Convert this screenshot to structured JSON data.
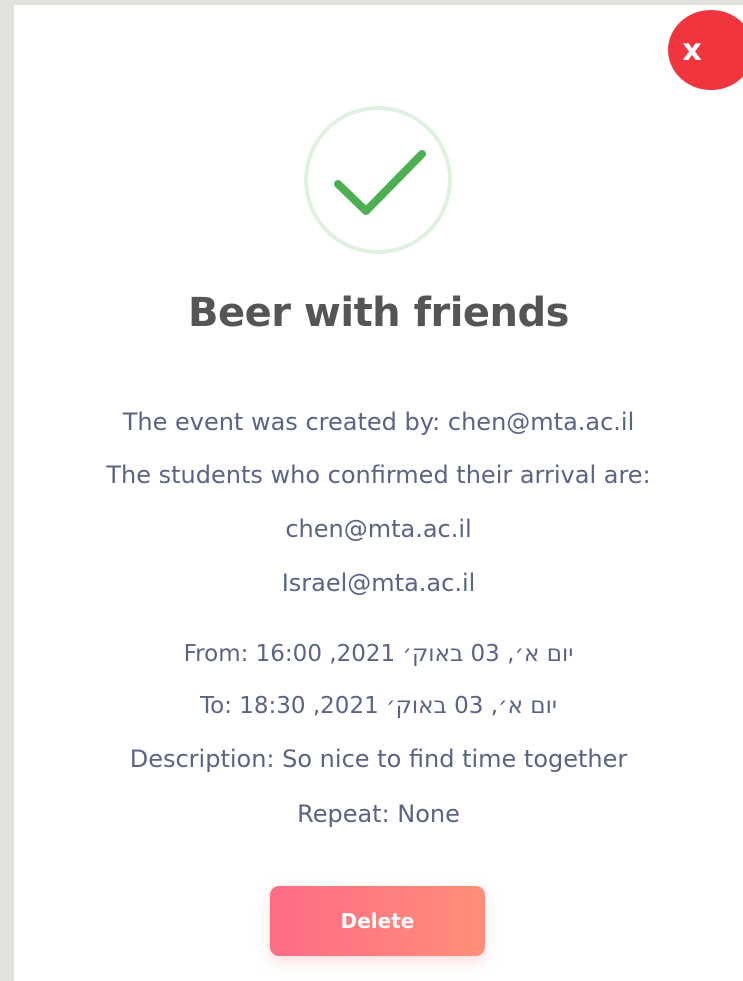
{
  "dialog": {
    "close_label": "x",
    "success_icon": "checkmark-icon",
    "title": "Beer with friends",
    "created_by": "The event was created by: chen@mta.ac.il",
    "confirmed_heading": "The students who confirmed their arrival are:",
    "confirmed_students": [
      "chen@mta.ac.il",
      "Israel@mta.ac.il"
    ],
    "from": "From: 16:00 ,2021 יום א׳, 03 באוק׳",
    "to": "To: 18:30 ,2021 יום א׳, 03 באוק׳",
    "description": "Description: So nice to find time together",
    "repeat": "Repeat: None",
    "delete_label": "Delete"
  },
  "colors": {
    "close_button": "#f0353f",
    "check": "#4caf50",
    "check_ring": "#dff1df",
    "title": "#555555",
    "body_text": "#5b6485",
    "delete_gradient_start": "#ff6b86",
    "delete_gradient_end": "#ff8f78"
  }
}
